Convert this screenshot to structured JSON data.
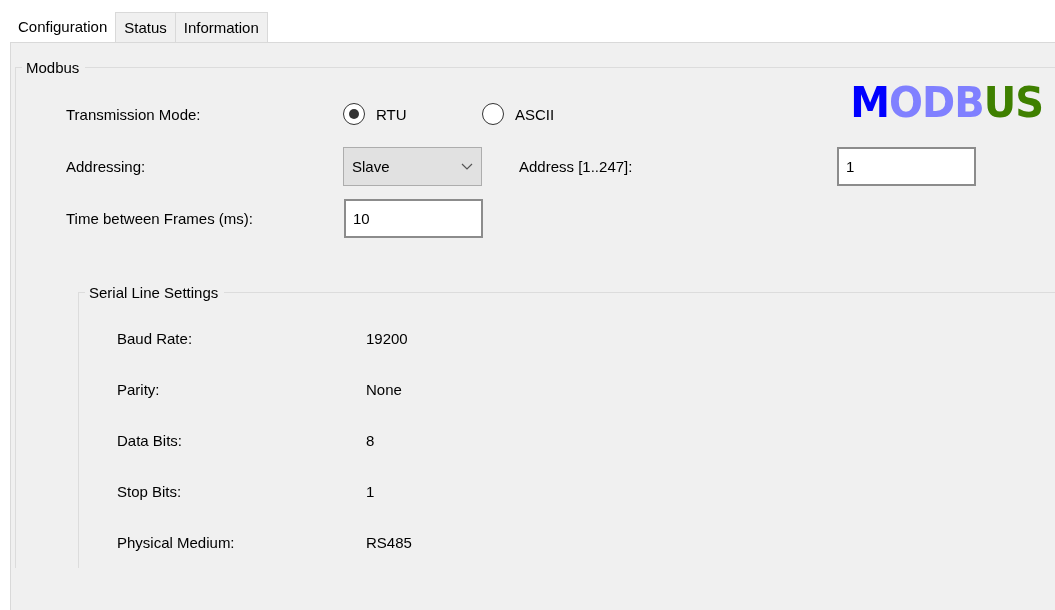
{
  "tabs": [
    {
      "label": "Configuration",
      "selected": true
    },
    {
      "label": "Status",
      "selected": false
    },
    {
      "label": "Information",
      "selected": false
    }
  ],
  "modbus": {
    "title": "Modbus",
    "logo": [
      {
        "text": "M",
        "color": "#0000ff"
      },
      {
        "text": "ODB",
        "color": "#8080ff"
      },
      {
        "text": "US",
        "color": "#3f8000"
      }
    ],
    "transmission_mode": {
      "label": "Transmission Mode:",
      "options": [
        {
          "label": "RTU",
          "selected": true
        },
        {
          "label": "ASCII",
          "selected": false
        }
      ]
    },
    "addressing": {
      "label": "Addressing:",
      "value": "Slave"
    },
    "address": {
      "label": "Address [1..247]:",
      "value": "1"
    },
    "time_between_frames": {
      "label": "Time between Frames (ms):",
      "value": "10"
    }
  },
  "serial_line_settings": {
    "title": "Serial Line Settings",
    "rows": [
      {
        "label": "Baud Rate:",
        "value": "19200"
      },
      {
        "label": "Parity:",
        "value": "None"
      },
      {
        "label": "Data Bits:",
        "value": "8"
      },
      {
        "label": "Stop Bits:",
        "value": "1"
      },
      {
        "label": "Physical Medium:",
        "value": "RS485"
      }
    ]
  }
}
